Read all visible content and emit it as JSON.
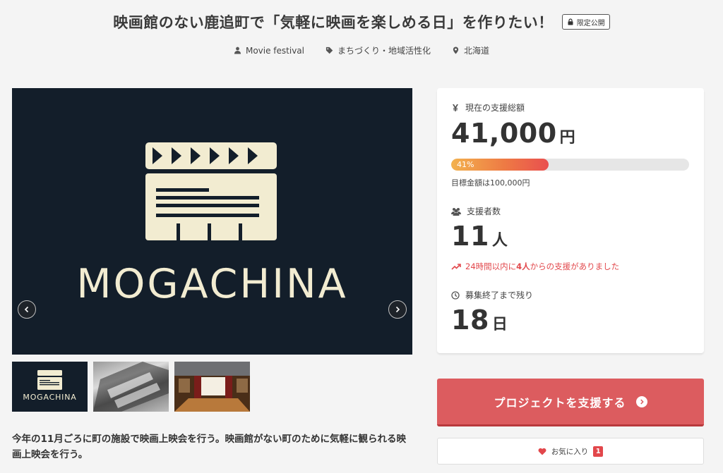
{
  "header": {
    "title": "映画館のない鹿追町で「気軽に映画を楽しめる日」を作りたい！",
    "badge": "限定公開",
    "meta": {
      "owner": "Movie festival",
      "category": "まちづくり・地域活性化",
      "location": "北海道"
    }
  },
  "hero": {
    "logo_text": "MOGACHINA"
  },
  "thumbnails": [
    {
      "label": "MOGACHINA"
    },
    {
      "label": ""
    },
    {
      "label": ""
    }
  ],
  "description": "今年の11月ごろに町の施設で映画上映会を行う。映画館がない町のために気軽に観られる映画上映会を行う。",
  "stats": {
    "total_label": "現在の支援総額",
    "total_value": "41,000",
    "total_unit": "円",
    "progress_percent": 41,
    "progress_text": "41%",
    "goal_text": "目標金額は100,000円",
    "supporters_label": "支援者数",
    "supporters_value": "11",
    "supporters_unit": "人",
    "recent_prefix": "24時間以内に",
    "recent_count": "4人",
    "recent_suffix": "からの支援がありました",
    "remaining_label": "募集終了まで残り",
    "remaining_value": "18",
    "remaining_unit": "日"
  },
  "actions": {
    "support_button": "プロジェクトを支援する",
    "favorite_label": "お気に入り",
    "favorite_count": "1"
  },
  "colors": {
    "accent": "#dc5c5f",
    "alert": "#e2474b",
    "hero_bg": "#131e2a",
    "logo": "#f2ecd1"
  }
}
